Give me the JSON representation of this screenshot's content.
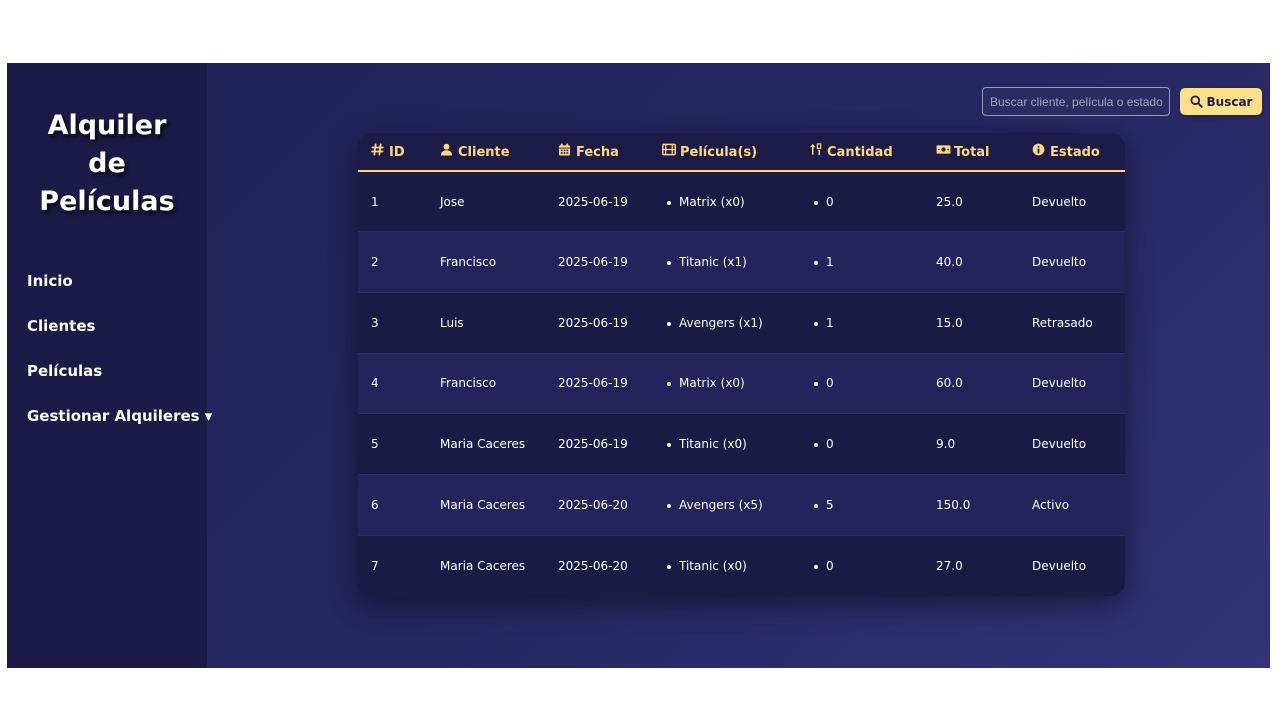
{
  "sidebar": {
    "title_line1": "Alquiler de",
    "title_line2": "Películas",
    "items": [
      {
        "label": "Inicio"
      },
      {
        "label": "Clientes"
      },
      {
        "label": "Películas"
      },
      {
        "label": "Gestionar Alquileres ▾"
      }
    ]
  },
  "search": {
    "placeholder": "Buscar cliente, película o estado",
    "value": "",
    "button_label": "Buscar"
  },
  "table": {
    "headers": [
      {
        "label": "ID",
        "icon": "hash-icon"
      },
      {
        "label": "Cliente",
        "icon": "user-icon"
      },
      {
        "label": "Fecha",
        "icon": "calendar-icon"
      },
      {
        "label": "Película(s)",
        "icon": "film-icon"
      },
      {
        "label": "Cantidad",
        "icon": "sort-numeric-icon"
      },
      {
        "label": "Total",
        "icon": "money-icon"
      },
      {
        "label": "Estado",
        "icon": "info-icon"
      }
    ],
    "rows": [
      {
        "id": "1",
        "cliente": "Jose",
        "fecha": "2025-06-19",
        "pelicula": "Matrix (x0)",
        "cantidad": "0",
        "total": "25.0",
        "estado": "Devuelto"
      },
      {
        "id": "2",
        "cliente": "Francisco",
        "fecha": "2025-06-19",
        "pelicula": "Titanic (x1)",
        "cantidad": "1",
        "total": "40.0",
        "estado": "Devuelto"
      },
      {
        "id": "3",
        "cliente": "Luis",
        "fecha": "2025-06-19",
        "pelicula": "Avengers (x1)",
        "cantidad": "1",
        "total": "15.0",
        "estado": "Retrasado"
      },
      {
        "id": "4",
        "cliente": "Francisco",
        "fecha": "2025-06-19",
        "pelicula": "Matrix (x0)",
        "cantidad": "0",
        "total": "60.0",
        "estado": "Devuelto"
      },
      {
        "id": "5",
        "cliente": "Maria Caceres",
        "fecha": "2025-06-19",
        "pelicula": "Titanic (x0)",
        "cantidad": "0",
        "total": "9.0",
        "estado": "Devuelto"
      },
      {
        "id": "6",
        "cliente": "Maria Caceres",
        "fecha": "2025-06-20",
        "pelicula": "Avengers (x5)",
        "cantidad": "5",
        "total": "150.0",
        "estado": "Activo"
      },
      {
        "id": "7",
        "cliente": "Maria Caceres",
        "fecha": "2025-06-20",
        "pelicula": "Titanic (x0)",
        "cantidad": "0",
        "total": "27.0",
        "estado": "Devuelto"
      }
    ]
  },
  "colors": {
    "accent": "#ffd97a",
    "sidebar_bg": "#1c1b47",
    "main_bg": "#262661",
    "row_dark": "#1c1b46",
    "row_light": "#24235c"
  }
}
